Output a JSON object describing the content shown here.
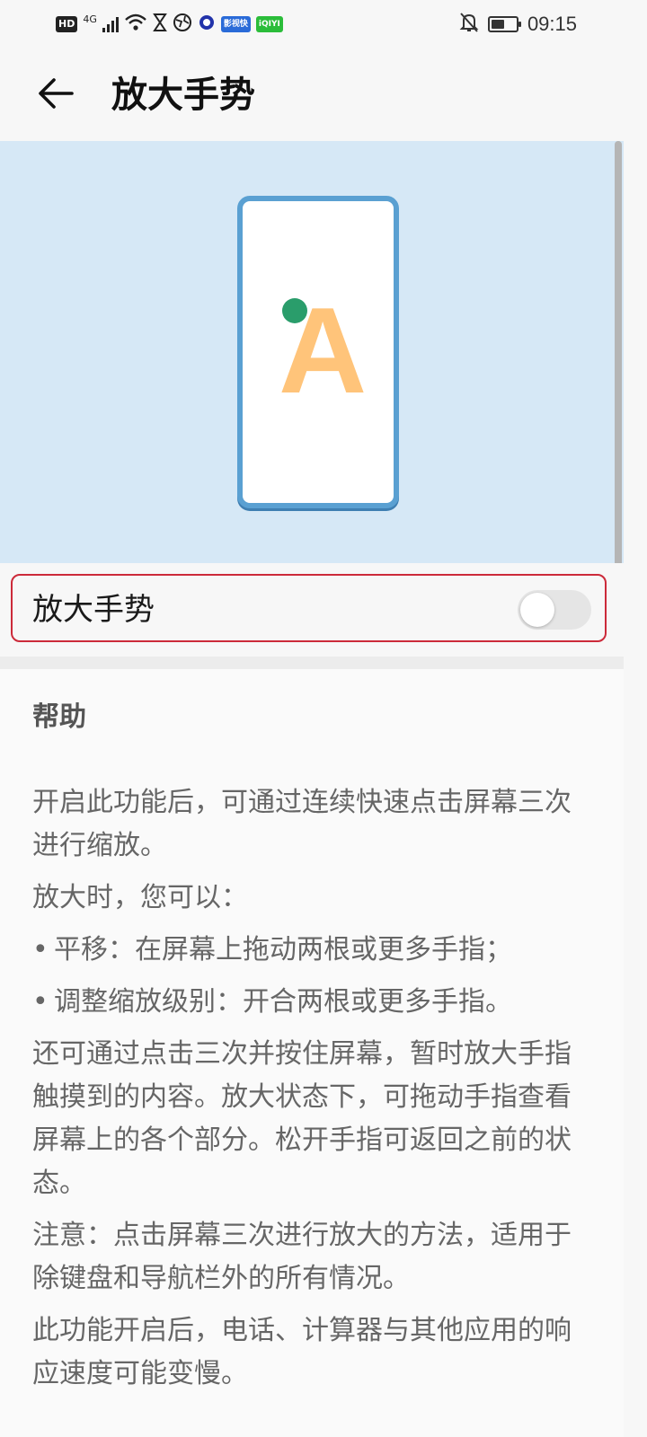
{
  "status_bar": {
    "hd": "HD",
    "network": "4G",
    "app1": "影视快",
    "app2": "iQIYI",
    "time": "09:15",
    "battery_level": 0.55
  },
  "header": {
    "title": "放大手势"
  },
  "setting": {
    "label": "放大手势",
    "enabled": false
  },
  "help": {
    "title": "帮助",
    "paragraphs": [
      "开启此功能后，可通过连续快速点击屏幕三次进行缩放。",
      "放大时，您可以：",
      "平移：在屏幕上拖动两根或更多手指；",
      "调整缩放级别：开合两根或更多手指。",
      "还可通过点击三次并按住屏幕，暂时放大手指触摸到的内容。放大状态下，可拖动手指查看屏幕上的各个部分。松开手指可返回之前的状态。",
      "注意：点击屏幕三次进行放大的方法，适用于除键盘和导航栏外的所有情况。",
      "此功能开启后，电话、计算器与其他应用的响应速度可能变慢。"
    ]
  },
  "illustration": {
    "letter": "A"
  },
  "colors": {
    "banner": "#d6e8f6",
    "phone_border": "#5aa0d2",
    "letter": "#ffc47a",
    "dot": "#2a9d6b",
    "highlight": "#cc2a3a"
  }
}
